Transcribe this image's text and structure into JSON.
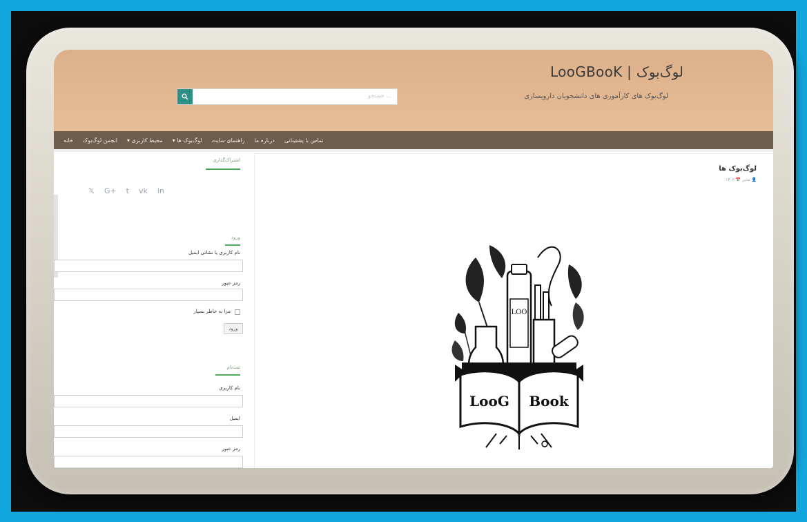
{
  "site": {
    "title": "LooGBooK | لوگ‌بوک",
    "tagline": "لوگ‌بوک های کارآموزی های دانشجویان دارویسازی",
    "search_placeholder": "جستجو ..."
  },
  "nav": {
    "items": [
      "خانه",
      "انجمن لوگ‌بوک",
      "محیط کاربری ▾",
      "لوگ‌بوک ها ▾",
      "راهنمای سایت",
      "درباره ما",
      "تماس با پشتیبانی"
    ]
  },
  "sidebar": {
    "share_title": "اشتراک‌گذاری",
    "social_icons": [
      "twitter-icon",
      "google-plus-icon",
      "tumblr-icon",
      "vk-icon",
      "linkedin-icon"
    ],
    "social_glyphs": [
      "𝕏",
      "G+",
      "t",
      "vk",
      "in"
    ],
    "login": {
      "title": "ورود",
      "username_label": "نام کاربری یا نشانی ایمیل",
      "password_label": "رمز عبور",
      "remember_label": "مرا به خاطر بسپار",
      "submit_label": "ورود"
    },
    "register": {
      "title": "ثبت‌نام",
      "username_label": "نام کاربری",
      "email_label": "ایمیل",
      "password_label": "رمز عبور"
    }
  },
  "main": {
    "post_title": "لوگ‌بوک ها",
    "post_meta": "👤 مدیر   📅 ۱۴۰۲",
    "illustration_text": "LooGBook"
  },
  "colors": {
    "header_bg": "#e0b38c",
    "nav_bg": "#6e5d4d",
    "accent_green": "#4caa5a",
    "search_button": "#2e8f87",
    "outer_bg": "#12a6dc"
  }
}
